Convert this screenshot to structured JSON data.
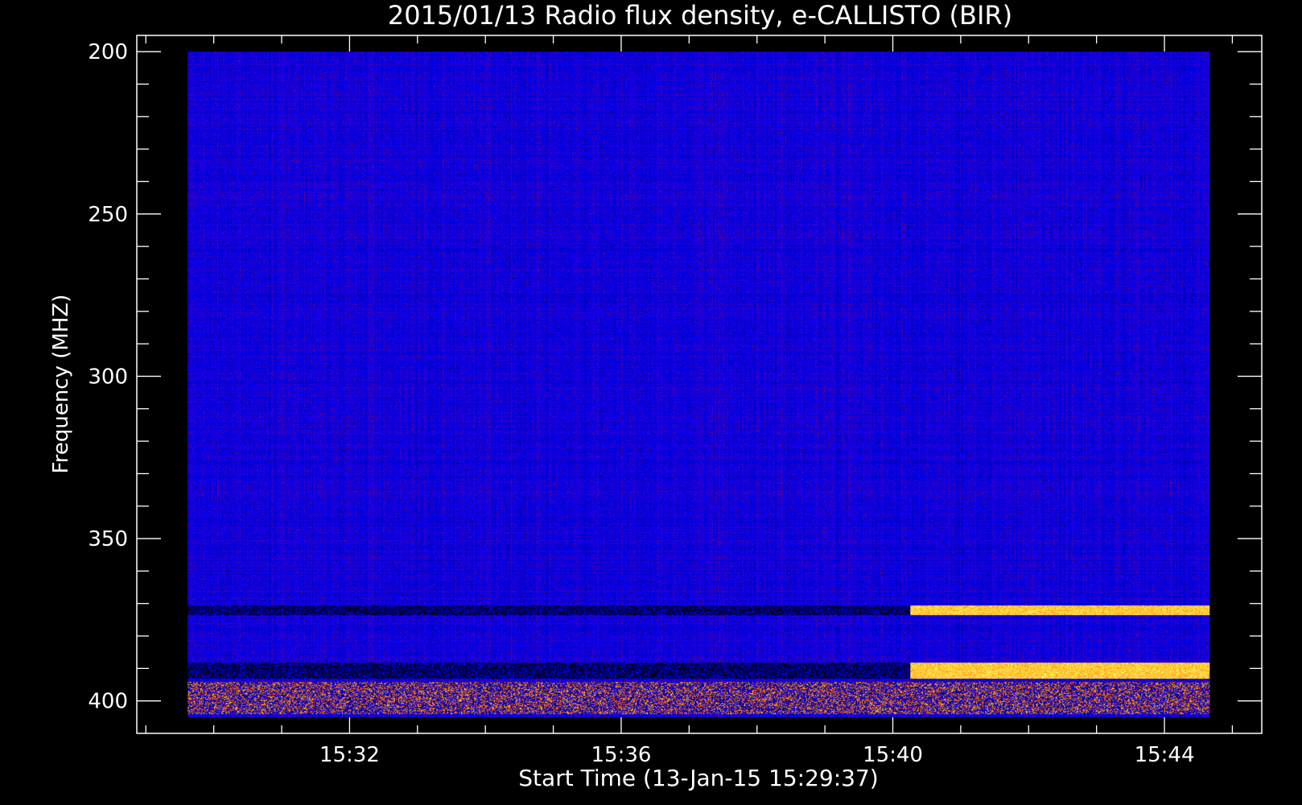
{
  "chart_data": {
    "type": "heatmap",
    "title": "2015/01/13  Radio flux density, e-CALLISTO (BIR)",
    "xlabel": "Start Time (13-Jan-15 15:29:37)",
    "ylabel": "Frequency (MHZ)",
    "x_start": "15:29:37",
    "x_end": "15:44:40",
    "xlim": [
      "15:28:52",
      "15:45:26"
    ],
    "x_ticks": [
      "15:32",
      "15:36",
      "15:40",
      "15:44"
    ],
    "ylim": [
      195,
      410
    ],
    "y_inverted": true,
    "y_ticks": [
      200,
      250,
      300,
      350,
      400
    ],
    "y_range": [
      200,
      405
    ],
    "colormap": [
      "#000000",
      "#0000ff",
      "#cc0000",
      "#ff8800",
      "#ffff66"
    ],
    "bands": [
      {
        "f0": 370.5,
        "f1": 373.5,
        "before": "dark",
        "after": "bright",
        "switch": "15:40:15"
      },
      {
        "f0": 388,
        "f1": 393,
        "before": "dark",
        "after": "bright",
        "switch": "15:40:15"
      },
      {
        "f0": 394,
        "f1": 404,
        "before": "hot",
        "after": "hot",
        "switch": "15:40:15"
      }
    ],
    "colors": {
      "background": "#000000",
      "axes": "#ffffff",
      "text": "#ffffff"
    }
  }
}
